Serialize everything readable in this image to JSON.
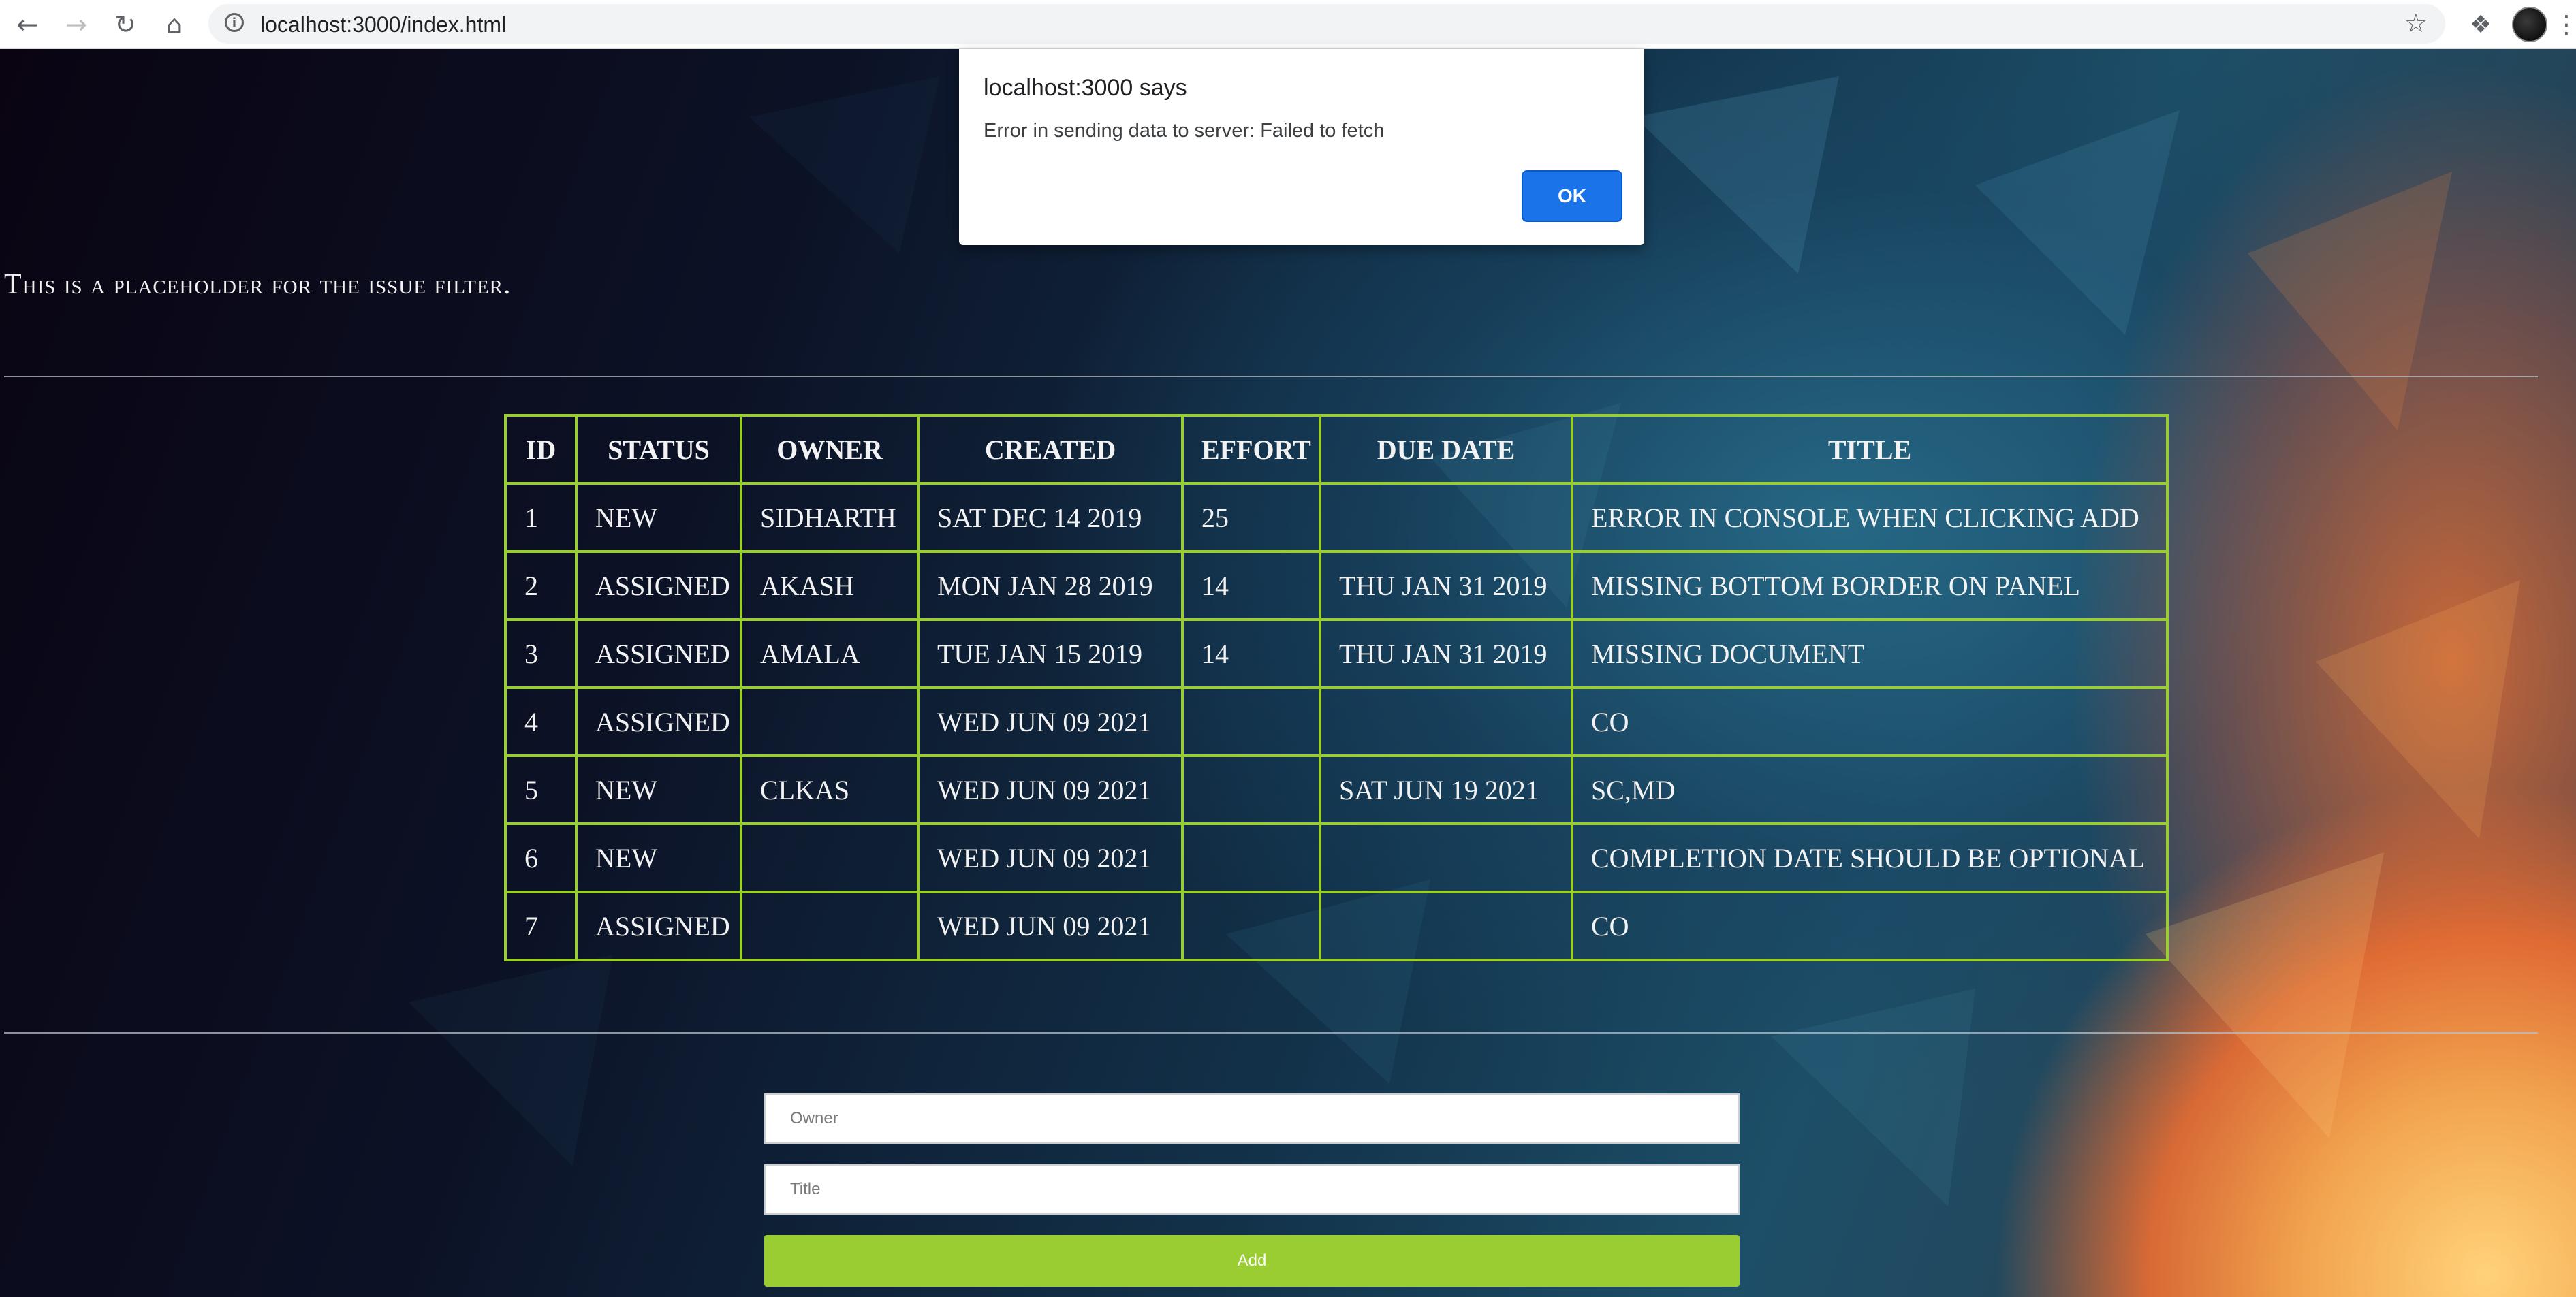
{
  "browser": {
    "url": "localhost:3000/index.html",
    "icons": {
      "back": "arrow-left-icon",
      "forward": "arrow-right-icon",
      "reload": "reload-icon",
      "home": "home-icon",
      "site_info": "info-icon",
      "bookmark": "star-icon",
      "extensions": "puzzle-icon",
      "menu": "more-vert-icon"
    }
  },
  "dialog": {
    "origin": "localhost:3000 says",
    "message": "Error in sending data to server: Failed to fetch",
    "ok_label": "OK"
  },
  "issue_filter": {
    "text": "This is a placeholder for the issue filter."
  },
  "issue_table": {
    "headers": [
      "Id",
      "Status",
      "Owner",
      "Created",
      "Effort",
      "Due Date",
      "Title"
    ],
    "rows": [
      [
        "1",
        "New",
        "Sidharth",
        "Sat Dec 14 2019",
        "25",
        "",
        "Error in console when clicking Add"
      ],
      [
        "2",
        "Assigned",
        "Akash",
        "Mon Jan 28 2019",
        "14",
        "Thu Jan 31 2019",
        "Missing bottom border on panel"
      ],
      [
        "3",
        "Assigned",
        "Amala",
        "Tue Jan 15 2019",
        "14",
        "Thu Jan 31 2019",
        "Missing Document"
      ],
      [
        "4",
        "Assigned",
        "",
        "Wed Jun 09 2021",
        "",
        "",
        "co"
      ],
      [
        "5",
        "New",
        "clkas",
        "Wed Jun 09 2021",
        "",
        "Sat Jun 19 2021",
        "sc,md"
      ],
      [
        "6",
        "New",
        "",
        "Wed Jun 09 2021",
        "",
        "",
        "completion date should be optional"
      ],
      [
        "7",
        "Assigned",
        "",
        "Wed Jun 09 2021",
        "",
        "",
        "co"
      ]
    ]
  },
  "add_form": {
    "owner_placeholder": "Owner",
    "title_placeholder": "Title",
    "add_label": "Add"
  },
  "colors": {
    "accent": "#9acd32",
    "dialog_button": "#1a73e8"
  }
}
